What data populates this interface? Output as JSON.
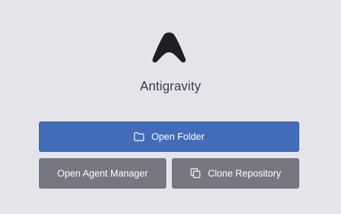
{
  "app": {
    "name": "Antigravity",
    "logo_icon": "antigravity-logo-icon"
  },
  "actions": {
    "open_folder": {
      "label": "Open Folder",
      "icon": "folder-icon"
    },
    "open_agent_manager": {
      "label": "Open Agent Manager"
    },
    "clone_repository": {
      "label": "Clone Repository",
      "icon": "copy-icon"
    }
  },
  "colors": {
    "background": "#e4e5ea",
    "primary_button": "#426cb8",
    "secondary_button": "#767782",
    "logo": "#1f1f22",
    "text": "#3b3d45"
  }
}
